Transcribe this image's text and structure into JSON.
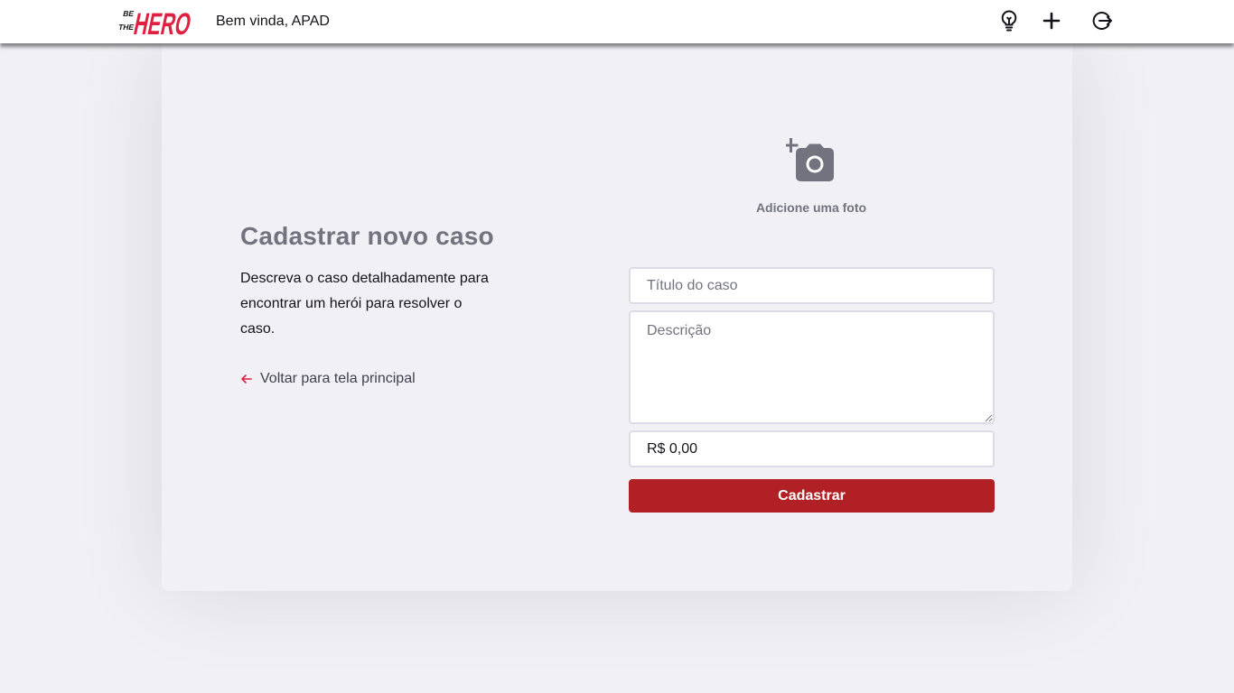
{
  "header": {
    "logo_top": "BE",
    "logo_mid": "THE",
    "logo_main": "HERO",
    "welcome": "Bem vinda, APAD",
    "icons": [
      "lightbulb-icon",
      "plus-icon",
      "logout-icon"
    ]
  },
  "left": {
    "title": "Cadastrar novo caso",
    "description": "Descreva o caso detalhadamente para encontrar um herói para resolver o caso.",
    "back_link": "Voltar para tela principal"
  },
  "photo": {
    "label": "Adicione uma foto",
    "icon": "add-photo-icon"
  },
  "form": {
    "title_placeholder": "Título do caso",
    "description_placeholder": "Descrição",
    "price_value": "R$ 0,00",
    "submit_label": "Cadastrar"
  },
  "colors": {
    "brand_red": "#e02041",
    "button_red": "#b02024",
    "background": "#f0f0f5",
    "muted_text": "#737380"
  }
}
